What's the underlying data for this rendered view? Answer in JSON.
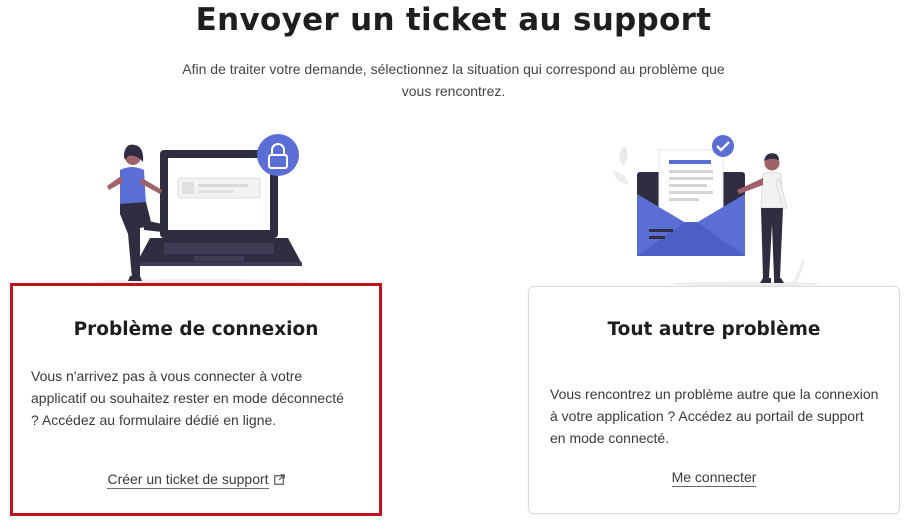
{
  "header": {
    "title": "Envoyer un ticket au support",
    "subtitle": "Afin de traiter votre demande, sélectionnez la situation qui correspond au problème que vous rencontrez."
  },
  "cards": [
    {
      "title": "Problème de connexion",
      "text": "Vous n'arrivez pas à vous connecter à votre applicatif ou souhaitez rester en mode déconnecté ? Accédez au formulaire dédié en ligne.",
      "link_label": "Créer un ticket de support",
      "link_icon": "external-link-icon",
      "selected": true
    },
    {
      "title": "Tout autre problème",
      "text": "Vous rencontrez un problème autre que la connexion à votre application ? Accédez au portail de support en mode connecté.",
      "link_label": "Me connecter",
      "selected": false
    }
  ],
  "illustrations": {
    "left": "woman-with-laptop-lock-illustration",
    "right": "man-with-envelope-document-illustration"
  },
  "colors": {
    "accent_blue": "#5b6ed6",
    "dark_navy": "#2f2e41",
    "selected_border": "#c0141c"
  }
}
